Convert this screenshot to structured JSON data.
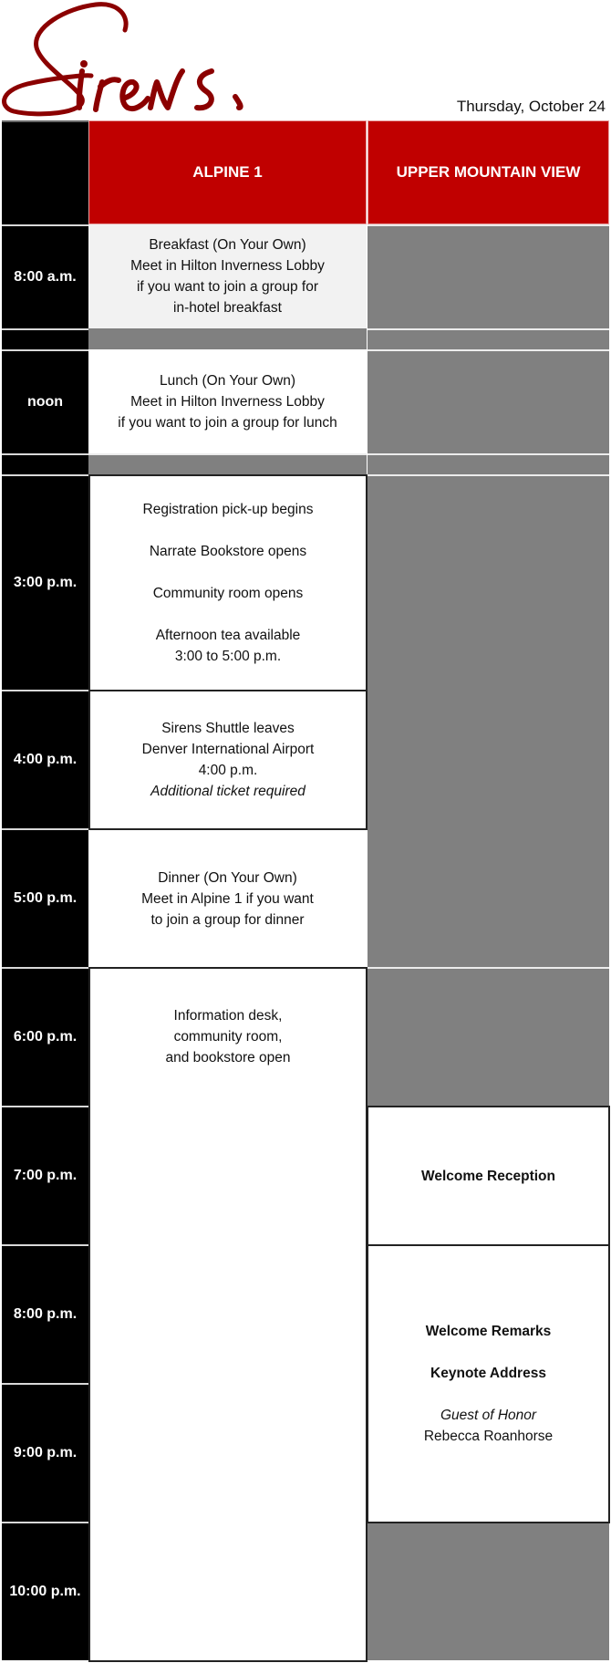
{
  "brand": {
    "logo_text": "Sirens",
    "logo_color": "#8b0000"
  },
  "date": "Thursday, October 24",
  "colors": {
    "header_red": "#c00000",
    "time_black": "#000000",
    "unavailable_gray": "#808080"
  },
  "columns": [
    "ALPINE 1",
    "UPPER MOUNTAIN VIEW"
  ],
  "times": {
    "t8am": "8:00 a.m.",
    "noon": "noon",
    "t3pm": "3:00 p.m.",
    "t4pm": "4:00 p.m.",
    "t5pm": "5:00 p.m.",
    "t6pm": "6:00 p.m.",
    "t7pm": "7:00 p.m.",
    "t8pm": "8:00 p.m.",
    "t9pm": "9:00 p.m.",
    "t10pm": "10:00 p.m."
  },
  "events": {
    "breakfast": [
      "Breakfast (On Your Own)",
      "Meet in Hilton Inverness Lobby",
      "if you want to join a group for",
      "in-hotel breakfast"
    ],
    "lunch": [
      "Lunch (On Your Own)",
      "Meet in Hilton Inverness Lobby",
      "if you want to join a group for lunch"
    ],
    "afternoon": [
      "Registration pick-up begins",
      "Narrate Bookstore opens",
      "Community room opens",
      "Afternoon tea available",
      "3:00 to 5:00 p.m."
    ],
    "shuttle": [
      "Sirens Shuttle leaves",
      "Denver International Airport",
      "4:00 p.m.",
      "Additional ticket required"
    ],
    "dinner": [
      "Dinner (On Your Own)",
      "Meet in Alpine 1 if you want",
      "to join a group for dinner"
    ],
    "info_desk": [
      "Information desk,",
      "community room,",
      "and bookstore open"
    ],
    "reception": "Welcome Reception",
    "keynote": [
      "Welcome Remarks",
      "Keynote Address",
      "Guest of Honor",
      "Rebecca Roanhorse"
    ]
  }
}
